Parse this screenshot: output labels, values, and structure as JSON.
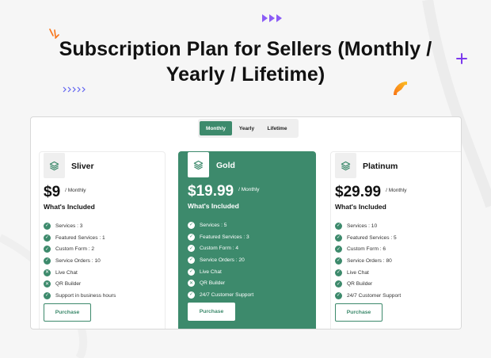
{
  "headline": {
    "line1": "Subscription Plan for Sellers (Monthly /",
    "line2": "Yearly / Lifetime)"
  },
  "colors": {
    "accent": "#3d8a6c",
    "decor_purple": "#8b5cf6",
    "decor_orange": "#f97316",
    "decor_blue": "#6366f1"
  },
  "tabs": [
    {
      "label": "Monthly",
      "active": true
    },
    {
      "label": "Yearly",
      "active": false
    },
    {
      "label": "Lifetime",
      "active": false
    }
  ],
  "plans": [
    {
      "name": "Sliver",
      "price": "$9",
      "period": "/ Monthly",
      "included_title": "What's Included",
      "features": [
        {
          "text": "Services : 3",
          "icon": "check"
        },
        {
          "text": "Featured Services : 1",
          "icon": "check"
        },
        {
          "text": "Custom Form : 2",
          "icon": "check"
        },
        {
          "text": "Service Orders : 10",
          "icon": "check"
        },
        {
          "text": "Live Chat",
          "icon": "cross"
        },
        {
          "text": "QR Builder",
          "icon": "cross"
        },
        {
          "text": "Support in business hours",
          "icon": "check"
        }
      ],
      "button": "Purchase"
    },
    {
      "name": "Gold",
      "price": "$19.99",
      "period": "/ Monthly",
      "included_title": "What's Included",
      "features": [
        {
          "text": "Services : 5",
          "icon": "check"
        },
        {
          "text": "Featured Services : 3",
          "icon": "check"
        },
        {
          "text": "Custom Form : 4",
          "icon": "check"
        },
        {
          "text": "Service Orders : 20",
          "icon": "check"
        },
        {
          "text": "Live Chat",
          "icon": "check"
        },
        {
          "text": "QR Builder",
          "icon": "cross"
        },
        {
          "text": "24/7 Customer Support",
          "icon": "check"
        }
      ],
      "button": "Purchase"
    },
    {
      "name": "Platinum",
      "price": "$29.99",
      "period": "/ Monthly",
      "included_title": "What's Included",
      "features": [
        {
          "text": "Services : 10",
          "icon": "check"
        },
        {
          "text": "Featured Services : 5",
          "icon": "check"
        },
        {
          "text": "Custom Form : 6",
          "icon": "check"
        },
        {
          "text": "Service Orders : 80",
          "icon": "check"
        },
        {
          "text": "Live Chat",
          "icon": "check"
        },
        {
          "text": "QR Builder",
          "icon": "check"
        },
        {
          "text": "24/7 Customer Support",
          "icon": "check"
        }
      ],
      "button": "Purchase"
    }
  ]
}
